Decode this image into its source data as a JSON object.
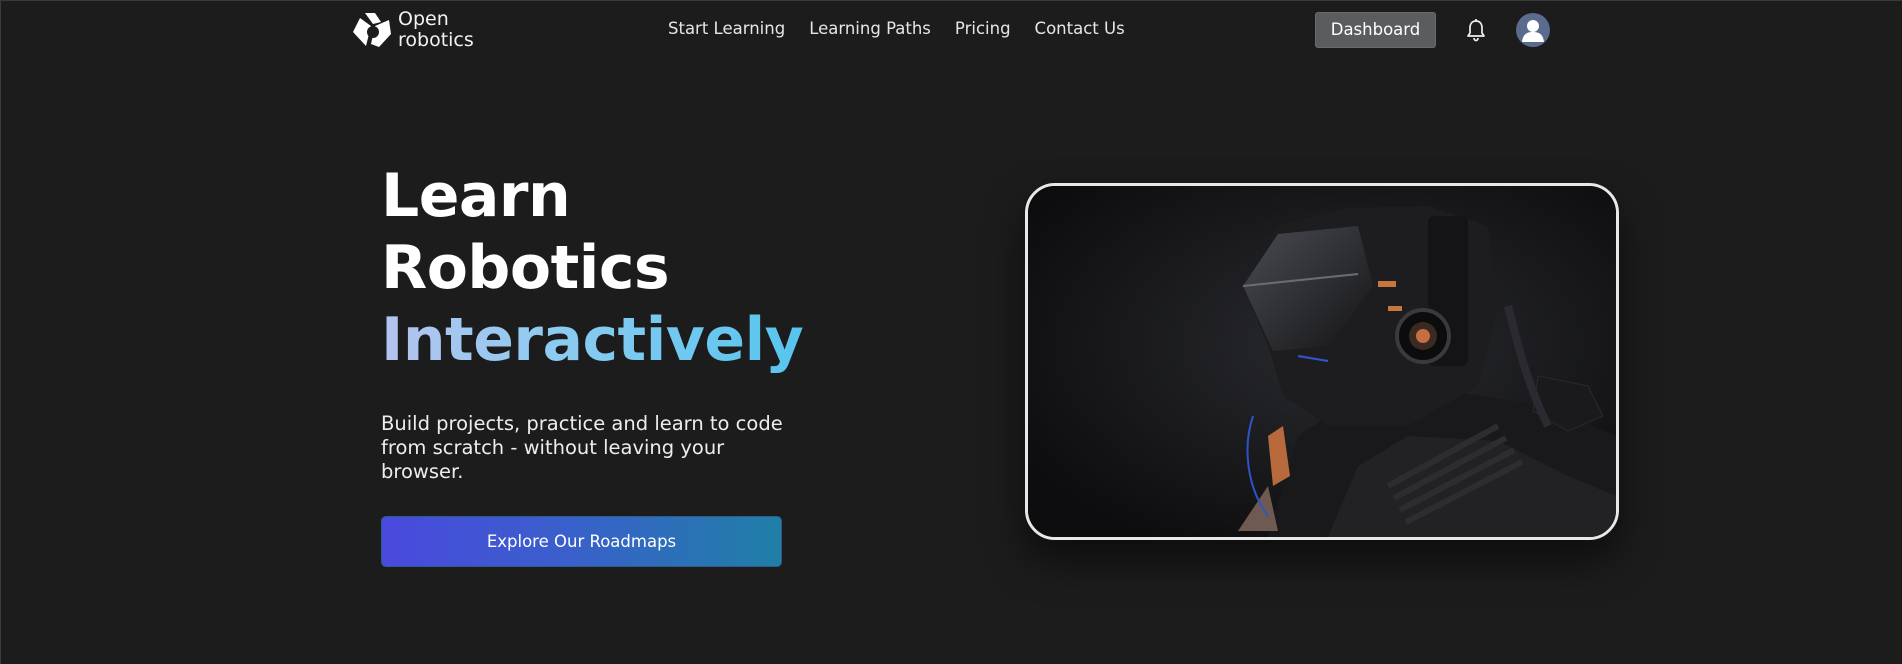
{
  "brand": {
    "line1": "Open",
    "line2": "robotics",
    "icon": "open-robotics-logo"
  },
  "nav": {
    "links": [
      "Start Learning",
      "Learning Paths",
      "Pricing",
      "Contact Us"
    ],
    "dashboard_label": "Dashboard",
    "notification_icon": "bell-icon",
    "avatar_icon": "user-avatar-icon"
  },
  "hero": {
    "title_line1": "Learn",
    "title_line2": "Robotics",
    "title_line3": "Interactively",
    "subtitle": "Build projects, practice and learn to code from scratch - without leaving your browser.",
    "cta_label": "Explore Our Roadmaps",
    "image_icon": "robot-image"
  },
  "colors": {
    "background": "#1c1c1d",
    "accent_gradient_start": "#4a49dd",
    "accent_gradient_end": "#1f7fa6",
    "headline_gradient_start": "#b5c3ee",
    "headline_gradient_end": "#56c5ee"
  }
}
